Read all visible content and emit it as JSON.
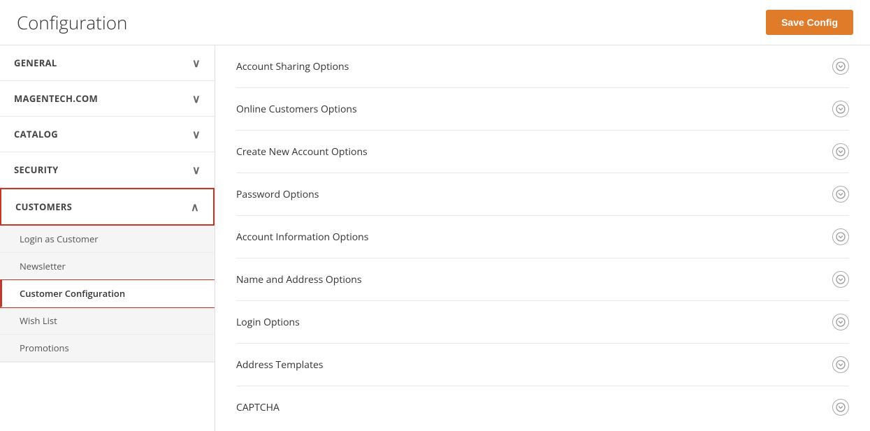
{
  "header": {
    "title": "Configuration",
    "save_button_label": "Save Config"
  },
  "sidebar": {
    "sections": [
      {
        "id": "general",
        "label": "GENERAL",
        "expanded": false,
        "active": false,
        "sub_items": []
      },
      {
        "id": "magentech",
        "label": "MAGENTECH.COM",
        "expanded": false,
        "active": false,
        "sub_items": []
      },
      {
        "id": "catalog",
        "label": "CATALOG",
        "expanded": false,
        "active": false,
        "sub_items": []
      },
      {
        "id": "security",
        "label": "SECURITY",
        "expanded": false,
        "active": false,
        "sub_items": []
      },
      {
        "id": "customers",
        "label": "CUSTOMERS",
        "expanded": true,
        "active": true,
        "sub_items": [
          {
            "id": "login-as-customer",
            "label": "Login as Customer",
            "active": false
          },
          {
            "id": "newsletter",
            "label": "Newsletter",
            "active": false
          },
          {
            "id": "customer-configuration",
            "label": "Customer Configuration",
            "active": true
          },
          {
            "id": "wish-list",
            "label": "Wish List",
            "active": false
          },
          {
            "id": "promotions",
            "label": "Promotions",
            "active": false
          }
        ]
      }
    ]
  },
  "content": {
    "items": [
      {
        "id": "account-sharing",
        "label": "Account Sharing Options"
      },
      {
        "id": "online-customers",
        "label": "Online Customers Options"
      },
      {
        "id": "create-new-account",
        "label": "Create New Account Options"
      },
      {
        "id": "password-options",
        "label": "Password Options"
      },
      {
        "id": "account-information",
        "label": "Account Information Options"
      },
      {
        "id": "name-address",
        "label": "Name and Address Options"
      },
      {
        "id": "login-options",
        "label": "Login Options"
      },
      {
        "id": "address-templates",
        "label": "Address Templates"
      },
      {
        "id": "captcha",
        "label": "CAPTCHA"
      }
    ]
  },
  "icons": {
    "chevron_down": "∨",
    "chevron_up": "∧",
    "expand_circle": "⊙"
  }
}
